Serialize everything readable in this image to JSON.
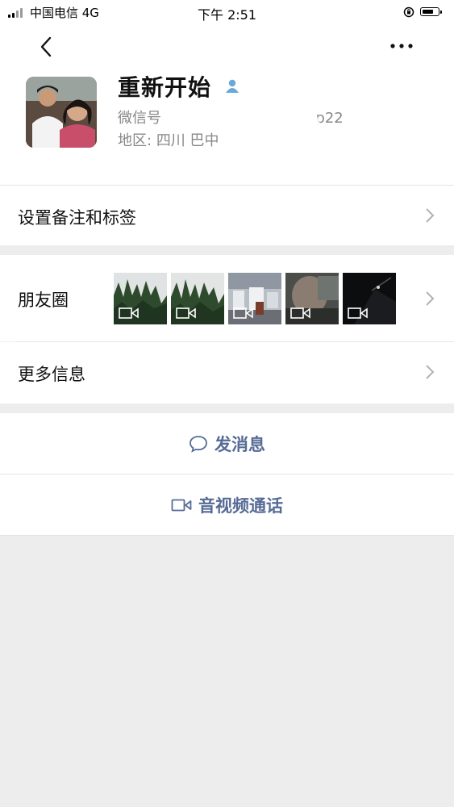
{
  "status_bar": {
    "carrier": "中国电信  4G",
    "time": "下午 2:51"
  },
  "profile": {
    "name": "重新开始",
    "wechat_id_label": "微信号",
    "wechat_id_suffix": "np22",
    "region_label": "地区:",
    "region_value": "四川 巴中"
  },
  "menu": {
    "remark": "设置备注和标签",
    "moments": "朋友圈",
    "more_info": "更多信息"
  },
  "actions": {
    "send_message": "发消息",
    "video_call": "音视频通话"
  },
  "colors": {
    "link": "#576b95",
    "background": "#ededed"
  },
  "icons": [
    "back-icon",
    "more-icon",
    "contact-icon",
    "chevron-right-icon",
    "video-icon",
    "chat-bubble-icon",
    "video-camera-icon"
  ]
}
